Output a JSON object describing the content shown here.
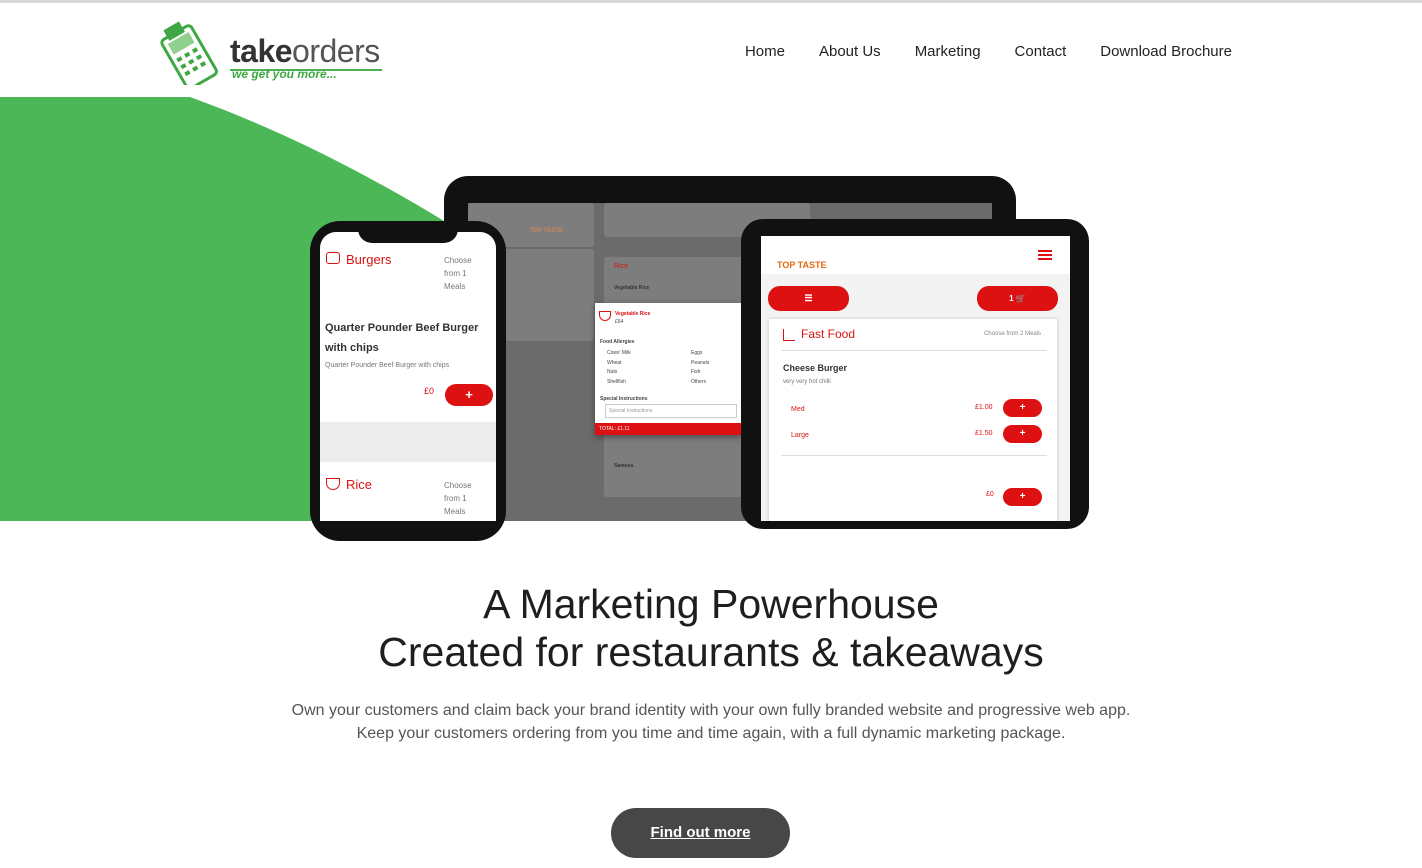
{
  "header": {
    "logo": {
      "brand_bold": "take",
      "brand_regular": "orders",
      "tagline": "we get you more..."
    },
    "nav": [
      "Home",
      "About Us",
      "Marketing",
      "Contact",
      "Download Brochure"
    ]
  },
  "hero_devices": {
    "phone": {
      "category1": "Burgers",
      "choose1": "Choose from 1 Meals",
      "item_title": "Quarter Pounder Beef Burger with chips",
      "item_desc": "Quarter Pounder Beef Burger with chips",
      "price": "£0",
      "add": "+",
      "category2": "Rice",
      "choose2": "Choose from 1 Meals"
    },
    "laptop": {
      "logo": "TOP TASTE",
      "card1": "Rice",
      "card1_item": "Vegetable Rice",
      "card2_item": "Samosa",
      "modal_title": "Vegetable Rice",
      "modal_price": "£64",
      "modal_section": "Food Allergies",
      "allergies": [
        "Cows' Milk",
        "Eggs",
        "Wheat",
        "Peanuts",
        "Nuts",
        "Fish",
        "Shellfish",
        "Others"
      ],
      "special_label": "Special Instructions",
      "special_placeholder": "Special Instructions",
      "total": "TOTAL: £1.11"
    },
    "tablet": {
      "logo": "TOP TASTE",
      "cart_count": "1",
      "category": "Fast Food",
      "choose": "Choose from 2 Meals",
      "item": "Cheese Burger",
      "item_desc": "very very hot chilli",
      "options": [
        {
          "name": "Med",
          "price": "£1.00"
        },
        {
          "name": "Large",
          "price": "£1.50"
        }
      ],
      "base_price": "£0",
      "add": "+"
    }
  },
  "main": {
    "headline_line1": "A Marketing Powerhouse",
    "headline_line2": "Created for restaurants & takeaways",
    "sub_line1": "Own your customers and claim back your brand identity with your own fully branded website and progressive web app.",
    "sub_line2": "Keep your customers ordering from you time and time again, with a full dynamic marketing package.",
    "cta": "Find out more"
  },
  "colors": {
    "green": "#4cb757",
    "red": "#dd1111",
    "cta": "#474747"
  }
}
